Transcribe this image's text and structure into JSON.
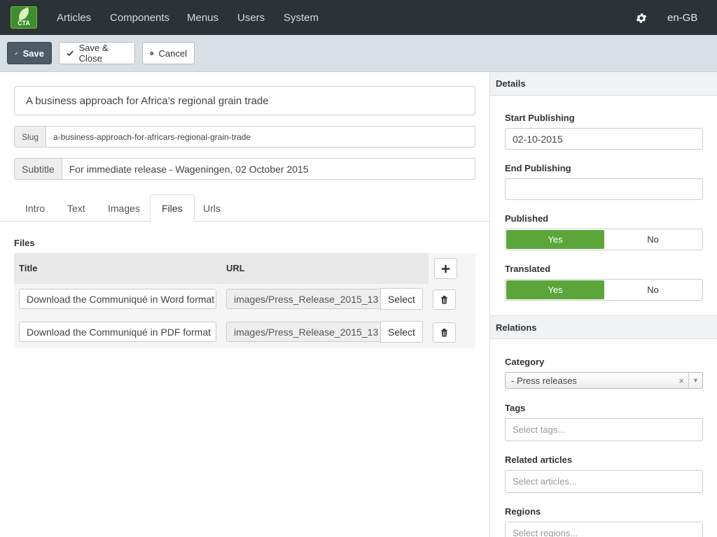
{
  "nav": {
    "logo_text": "CTA",
    "items": [
      "Articles",
      "Components",
      "Menus",
      "Users",
      "System"
    ],
    "language": "en-GB"
  },
  "toolbar": {
    "save": "Save",
    "save_close": "Save & Close",
    "cancel": "Cancel"
  },
  "article": {
    "title": "A business approach for Africa’s regional grain trade",
    "slug_label": "Slug",
    "slug": "a-business-approach-for-africars-regional-grain-trade",
    "subtitle_label": "Subtitle",
    "subtitle": "For immediate release - Wageningen, 02 October 2015"
  },
  "tabs": [
    "Intro",
    "Text",
    "Images",
    "Files",
    "Urls"
  ],
  "active_tab": "Files",
  "files": {
    "label": "Files",
    "col_title": "Title",
    "col_url": "URL",
    "select_label": "Select",
    "rows": [
      {
        "title": "Download the Communiqué in Word format",
        "url": "images/Press_Release_2015_13"
      },
      {
        "title": "Download the Communiqué in PDF format",
        "url": "images/Press_Release_2015_13"
      }
    ]
  },
  "details": {
    "header": "Details",
    "start_label": "Start Publishing",
    "start_value": "02-10-2015",
    "end_label": "End Publishing",
    "end_value": "",
    "published_label": "Published",
    "translated_label": "Translated",
    "yes": "Yes",
    "no": "No"
  },
  "relations": {
    "header": "Relations",
    "category_label": "Category",
    "category_value": "- Press releases",
    "tags_label": "Tags",
    "tags_placeholder": "Select tags...",
    "related_label": "Related articles",
    "related_placeholder": "Select articles...",
    "regions_label": "Regions",
    "regions_placeholder": "Select regions..."
  },
  "colors": {
    "nav_bg": "#2d3236",
    "toolbar_bg": "#d8e0e6",
    "primary_btn": "#4c5b66",
    "toggle_on": "#5ca53b"
  }
}
